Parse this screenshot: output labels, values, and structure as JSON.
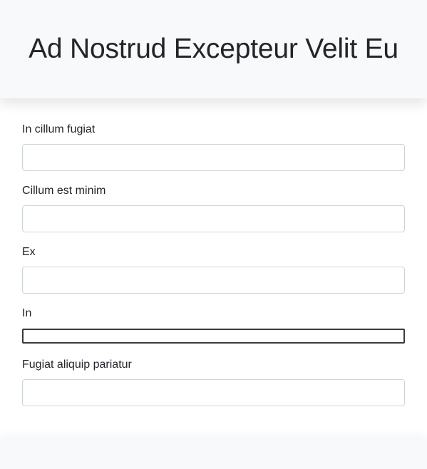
{
  "header": {
    "title": "Ad Nostrud Excepteur Velit Eu"
  },
  "form": {
    "fields": [
      {
        "label": "In cillum fugiat",
        "value": "",
        "placeholder": ""
      },
      {
        "label": "Cillum est minim",
        "value": "",
        "placeholder": ""
      },
      {
        "label": "Ex",
        "value": "",
        "placeholder": ""
      },
      {
        "label": "In",
        "value": "",
        "placeholder": ""
      },
      {
        "label": "Fugiat aliquip pariatur",
        "value": "",
        "placeholder": ""
      }
    ]
  },
  "colors": {
    "header_bg": "#f8f9fa",
    "text": "#212529",
    "input_border": "#ced4da",
    "plain_input_border": "#3a3a3a"
  }
}
